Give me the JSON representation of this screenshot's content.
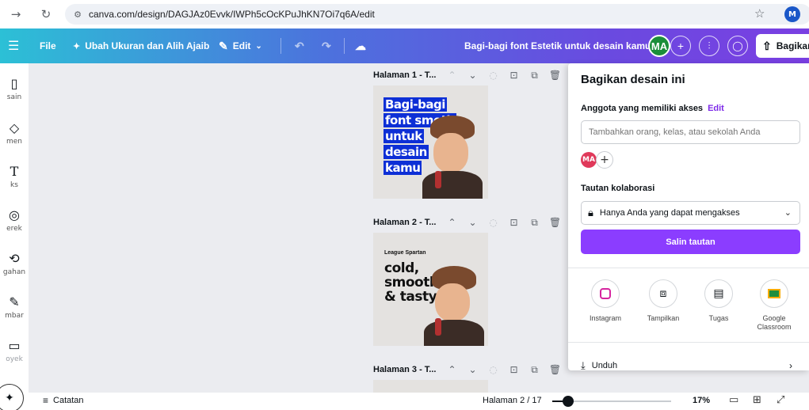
{
  "browser": {
    "url": "canva.com/design/DAGJAz0Evvk/IWPh5cOcKPuJhKN7Oi7q6A/edit",
    "profile_initial": "M"
  },
  "toolbar": {
    "file": "File",
    "resize": "Ubah Ukuran dan Alih Ajaib",
    "edit": "Edit",
    "doc_title": "Bagi-bagi font Estetik untuk desain kamu",
    "collab_initials": "MA",
    "share": "Bagikan"
  },
  "sidebar": {
    "items": [
      {
        "label": "sain"
      },
      {
        "label": "men"
      },
      {
        "label": "ks"
      },
      {
        "label": "erek"
      },
      {
        "label": "gahan"
      },
      {
        "label": "mbar"
      },
      {
        "label": "oyek"
      }
    ]
  },
  "pages": [
    {
      "label": "Halaman 1 - T..."
    },
    {
      "label": "Halaman 2 - T..."
    },
    {
      "label": "Halaman 3 - T..."
    }
  ],
  "thumb1": {
    "lines": [
      "Bagi-bagi",
      "font smoth",
      "untuk",
      "desain",
      "kamu"
    ]
  },
  "thumb2": {
    "small": "League Spartan",
    "big": [
      "cold,",
      "smooth",
      "& tasty."
    ]
  },
  "share_panel": {
    "title": "Bagikan desain ini",
    "access_label": "Anggota yang memiliki akses",
    "access_edit": "Edit",
    "input_placeholder": "Tambahkan orang, kelas, atau sekolah Anda",
    "avatar_initials": "MA",
    "collab_label": "Tautan kolaborasi",
    "collab_option": "Hanya Anda yang dapat mengakses",
    "copy_link": "Salin tautan",
    "apps": [
      {
        "label": "Instagram"
      },
      {
        "label": "Tampilkan"
      },
      {
        "label": "Tugas"
      },
      {
        "label": "Google Classroom"
      }
    ],
    "download": "Unduh"
  },
  "status": {
    "notes": "Catatan",
    "page_count": "Halaman 2 / 17",
    "zoom_percent": 17,
    "zoom_label": "17%"
  },
  "colors": {
    "accent": "#8b3dff",
    "highlight_blue": "#0d2fd6",
    "collab_green": "#1b8e3a",
    "avatar_red": "#e0395a"
  }
}
